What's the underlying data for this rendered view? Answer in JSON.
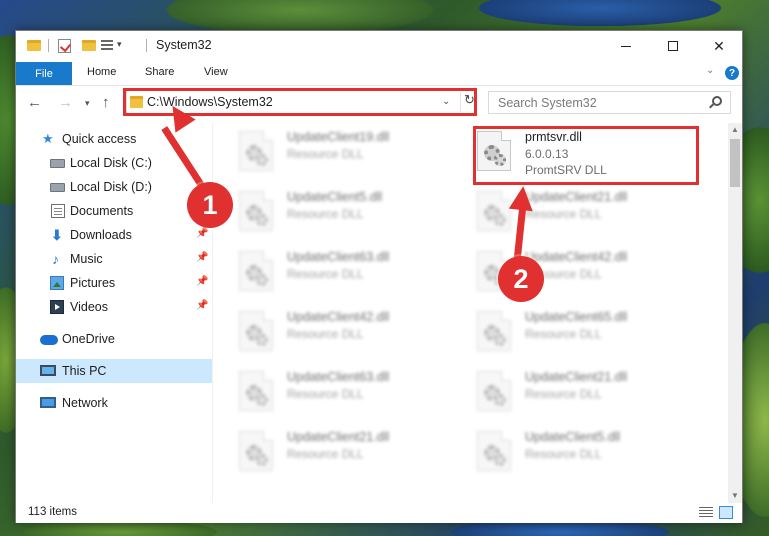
{
  "window": {
    "title": "System32",
    "quick_access_dropdown": "▾"
  },
  "ribbon": {
    "tabs": [
      {
        "label": "File"
      },
      {
        "label": "Home"
      },
      {
        "label": "Share"
      },
      {
        "label": "View"
      }
    ],
    "help_icon": "?"
  },
  "address": {
    "path": "C:\\Windows\\System32",
    "search_placeholder": "Search System32"
  },
  "sidebar": {
    "items": [
      {
        "label": "Quick access",
        "icon": "star-icon"
      },
      {
        "label": "Local Disk (C:)",
        "icon": "drive-icon"
      },
      {
        "label": "Local Disk (D:)",
        "icon": "drive-icon"
      },
      {
        "label": "Documents",
        "icon": "documents-icon"
      },
      {
        "label": "Downloads",
        "icon": "download-icon",
        "pinned": true
      },
      {
        "label": "Music",
        "icon": "music-icon",
        "pinned": true
      },
      {
        "label": "Pictures",
        "icon": "pictures-icon",
        "pinned": true
      },
      {
        "label": "Videos",
        "icon": "videos-icon",
        "pinned": true
      },
      {
        "label": "OneDrive",
        "icon": "onedrive-icon"
      },
      {
        "label": "This PC",
        "icon": "computer-icon",
        "selected": true
      },
      {
        "label": "Network",
        "icon": "network-icon"
      }
    ]
  },
  "files": {
    "left_column": [
      {
        "name": "UpdateClient19.dll",
        "type": "Resource DLL"
      },
      {
        "name": "UpdateClient5.dll",
        "type": "Resource DLL"
      },
      {
        "name": "UpdateClient63.dll",
        "type": "Resource DLL"
      },
      {
        "name": "UpdateClient42.dll",
        "type": "Resource DLL"
      },
      {
        "name": "UpdateClient63.dll",
        "type": "Resource DLL"
      },
      {
        "name": "UpdateClient21.dll",
        "type": "Resource DLL"
      }
    ],
    "right_column": [
      {
        "name": "UpdateClient21.dll",
        "type": "Resource DLL"
      },
      {
        "name": "UpdateClient42.dll",
        "type": "Resource DLL"
      },
      {
        "name": "UpdateClient65.dll",
        "type": "Resource DLL"
      },
      {
        "name": "UpdateClient21.dll",
        "type": "Resource DLL"
      },
      {
        "name": "UpdateClient5.dll",
        "type": "Resource DLL"
      }
    ],
    "highlighted": {
      "name": "prmtsvr.dll",
      "version": "6.0.0.13",
      "description": "PromtSRV DLL"
    }
  },
  "status": {
    "item_count": "113 items"
  },
  "annotations": {
    "step1": "1",
    "step2": "2",
    "color": "#e0302f"
  }
}
